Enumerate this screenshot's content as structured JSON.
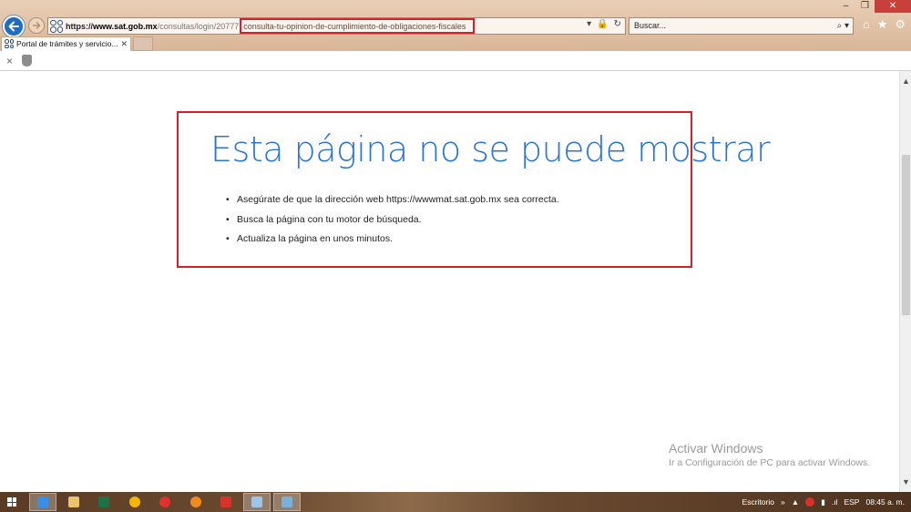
{
  "browser": {
    "address": {
      "protocol": "https://",
      "domain": "www.sat.gob.mx",
      "path": "/consultas/login/20777",
      "highlighted": "consulta-tu-opinion-de-cumplimiento-de-obligaciones-fiscales",
      "icons": [
        "dropdown-icon",
        "lock-icon",
        "refresh-icon"
      ]
    },
    "search": {
      "placeholder": "Buscar..."
    },
    "tab": {
      "title": "Portal de trámites y servicio...",
      "close": "✕"
    },
    "right_tools": [
      "home-icon",
      "favorites-star-icon",
      "settings-gear-icon"
    ],
    "window_controls": {
      "minimize": "–",
      "restore": "❐",
      "close": "✕"
    }
  },
  "commandbar": {
    "close": "×"
  },
  "error": {
    "title": "Esta página no se puede mostrar",
    "items": [
      "Asegúrate de que la dirección web https://wwwmat.sat.gob.mx sea correcta.",
      "Busca la página con tu motor de búsqueda.",
      "Actualiza la página en unos minutos."
    ]
  },
  "watermark": {
    "title": "Activar Windows",
    "subtitle": "Ir a Configuración de PC para activar Windows."
  },
  "taskbar": {
    "apps": [
      {
        "name": "internet-explorer-icon",
        "color": "#3a8ee6",
        "active": true
      },
      {
        "name": "file-explorer-icon",
        "color": "#e9c46a",
        "active": false
      },
      {
        "name": "excel-icon",
        "color": "#1e7145",
        "active": false
      },
      {
        "name": "chrome-icon",
        "color": "#f2b705",
        "active": false
      },
      {
        "name": "opera-icon",
        "color": "#e03030",
        "active": false
      },
      {
        "name": "firefox-icon",
        "color": "#f28a1e",
        "active": false
      },
      {
        "name": "vivaldi-icon",
        "color": "#d8322a",
        "active": false
      },
      {
        "name": "notepad-icon",
        "color": "#9fc4e8",
        "active": true
      },
      {
        "name": "network-app-icon",
        "color": "#7ab0d8",
        "active": true
      }
    ],
    "tray": {
      "desktop": "Escritorio",
      "chevron": "»",
      "up_arrow": "▲",
      "language": "ESP",
      "time": "08:45 a. m."
    }
  },
  "colors": {
    "chrome": "#d9b597",
    "accent_blue": "#2b74cf",
    "highlight_red": "#d2232a"
  }
}
